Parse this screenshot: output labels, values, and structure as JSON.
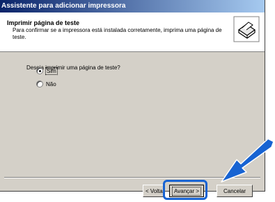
{
  "window": {
    "title": "Assistente para adicionar impressora"
  },
  "header": {
    "title": "Imprimir página de teste",
    "description": "Para confirmar se a impressora está instalada corretamente, imprima uma página de teste.",
    "icon": "printer-icon"
  },
  "content": {
    "question": "Deseja imprimir uma página de teste?",
    "options": [
      {
        "label": "Sim",
        "selected": true
      },
      {
        "label": "Não",
        "selected": false
      }
    ]
  },
  "buttons": {
    "back_label": "< Volta",
    "next_label": "Avançar >",
    "cancel_label": "Cancelar"
  },
  "annotation": {
    "arrow_color": "#1763d2",
    "highlight_color": "#1763d2"
  }
}
